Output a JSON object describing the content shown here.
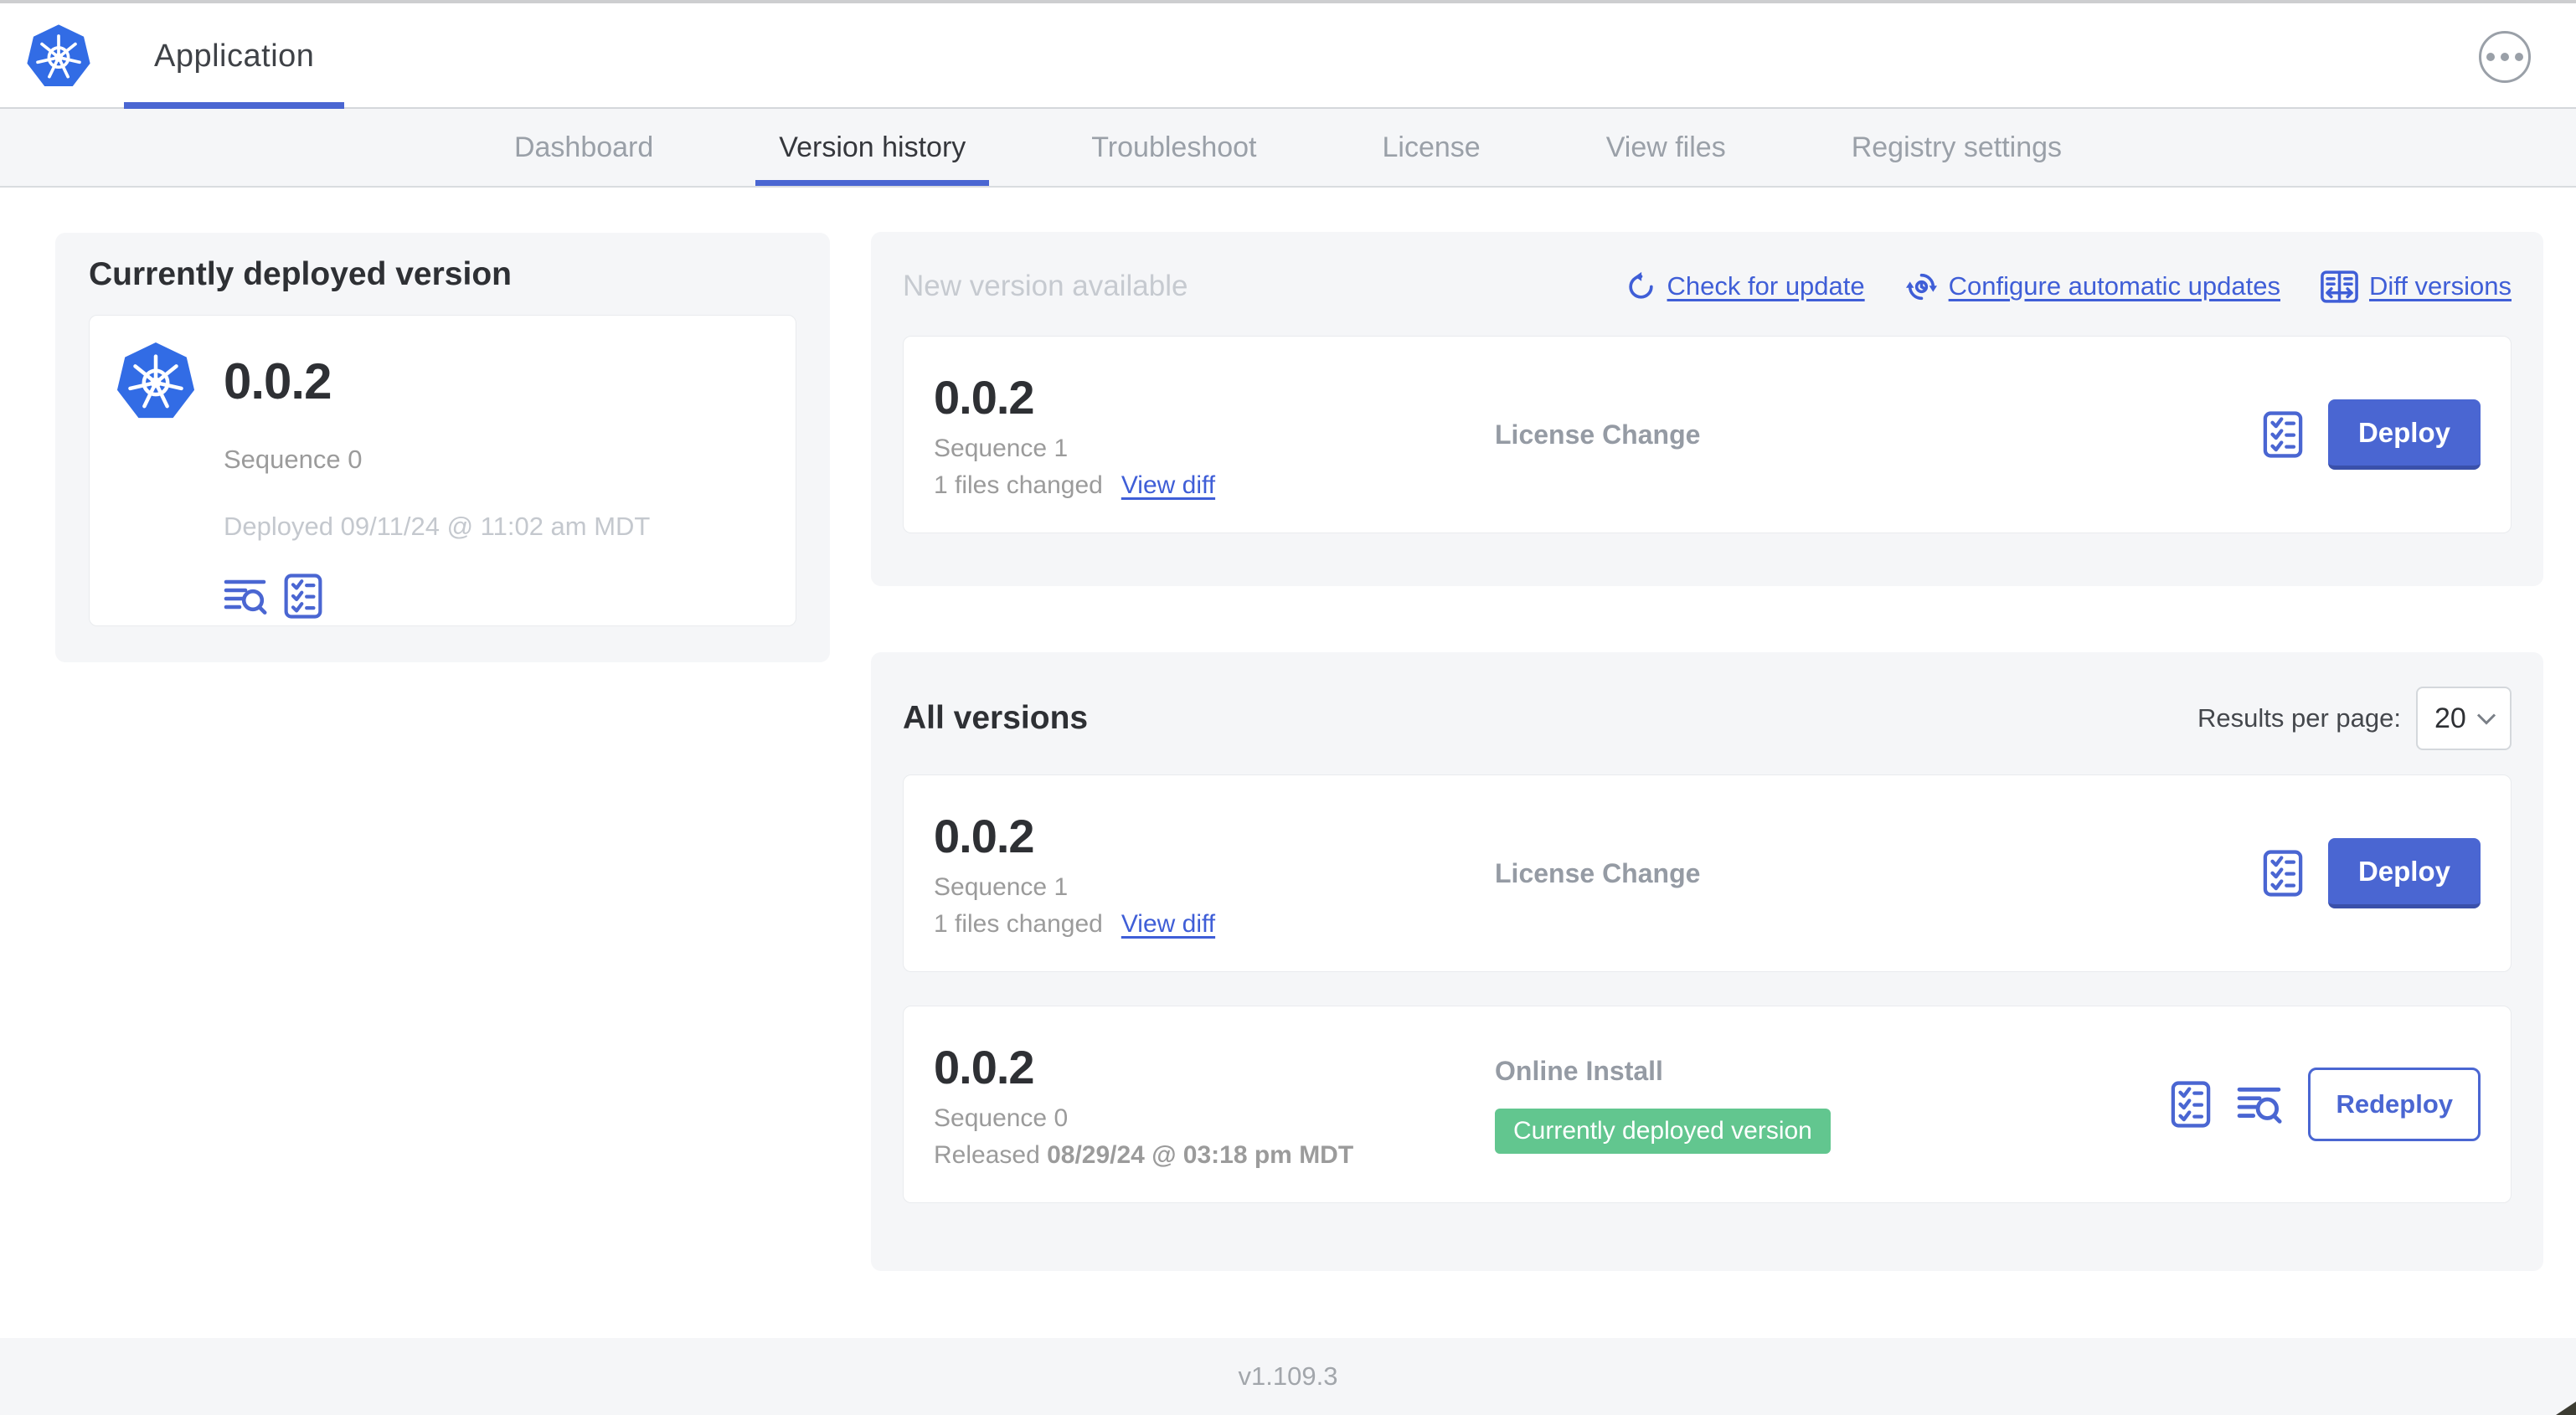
{
  "header": {
    "app_title": "Application"
  },
  "nav": {
    "tabs": [
      {
        "label": "Dashboard",
        "active": false
      },
      {
        "label": "Version history",
        "active": true
      },
      {
        "label": "Troubleshoot",
        "active": false
      },
      {
        "label": "License",
        "active": false
      },
      {
        "label": "View files",
        "active": false
      },
      {
        "label": "Registry settings",
        "active": false
      }
    ]
  },
  "current": {
    "heading": "Currently deployed version",
    "version": "0.0.2",
    "sequence": "Sequence 0",
    "deployed": "Deployed 09/11/24 @ 11:02 am MDT"
  },
  "new_version": {
    "heading": "New version available",
    "check_link": "Check for update",
    "configure_link": "Configure automatic updates",
    "diff_link": "Diff versions",
    "version": "0.0.2",
    "sequence": "Sequence 1",
    "files_changed": "1 files changed",
    "view_diff": "View diff",
    "source": "License Change",
    "deploy": "Deploy"
  },
  "all_versions": {
    "heading": "All versions",
    "results_label": "Results per page:",
    "results_value": "20",
    "rows": [
      {
        "version": "0.0.2",
        "sequence": "Sequence 1",
        "files_changed": "1 files changed",
        "view_diff": "View diff",
        "source": "License Change",
        "action": "Deploy"
      },
      {
        "version": "0.0.2",
        "sequence": "Sequence 0",
        "released_prefix": "Released ",
        "released_date": "08/29/24 @ 03:18 pm MDT",
        "source": "Online Install",
        "badge": "Currently deployed version",
        "action": "Redeploy"
      }
    ]
  },
  "footer": {
    "version": "v1.109.3"
  },
  "colors": {
    "accent_blue": "#4a66d2",
    "link_blue": "#3f5ed7",
    "kubernetes_blue": "#326ce5",
    "badge_green": "#62c68f",
    "panel_bg": "#f5f6f8",
    "muted_text": "#9b9b9b",
    "faint_text": "#c4c8ce"
  },
  "icons": {
    "app_logo": "kubernetes-wheel",
    "more": "ellipsis-circle",
    "check_update": "refresh-arrow",
    "configure_updates": "auto-update-clock",
    "diff": "split-columns-arrows",
    "logs": "lines-magnifier",
    "preflight": "checklist-clipboard",
    "select": "chevron-down"
  }
}
